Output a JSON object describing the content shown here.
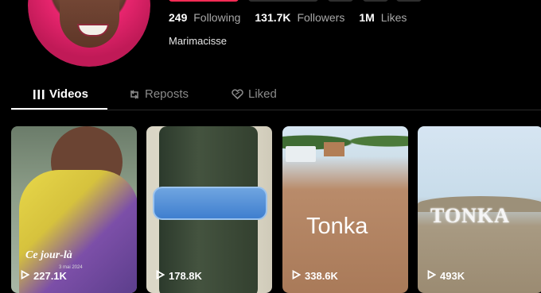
{
  "profile": {
    "username": "Marimacisse",
    "stats": [
      {
        "value": "249",
        "label": "Following"
      },
      {
        "value": "131.7K",
        "label": "Followers"
      },
      {
        "value": "1M",
        "label": "Likes"
      }
    ]
  },
  "tabs": [
    {
      "label": "Videos",
      "active": true,
      "icon": "grid-bars-icon"
    },
    {
      "label": "Reposts",
      "active": false,
      "icon": "repost-icon"
    },
    {
      "label": "Liked",
      "active": false,
      "icon": "heart-icon"
    }
  ],
  "videos": [
    {
      "views": "227.1K",
      "caption": "Ce jour-là",
      "subcaption": "3 mai 2024"
    },
    {
      "views": "178.8K"
    },
    {
      "views": "338.6K",
      "caption": "Tonka"
    },
    {
      "views": "493K",
      "caption": "TONKA"
    }
  ],
  "colors": {
    "accent": "#fe2c55",
    "background": "#000000",
    "muted": "#a8a8a8"
  }
}
